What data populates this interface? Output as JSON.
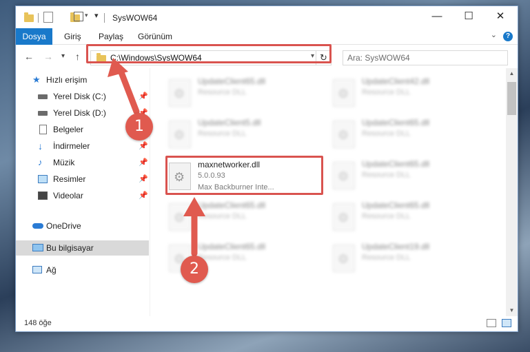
{
  "window": {
    "title": "SysWOW64"
  },
  "ribbon": {
    "tabs": [
      "Dosya",
      "Giriş",
      "Paylaş",
      "Görünüm"
    ],
    "help": "?"
  },
  "address": {
    "path": "C:\\Windows\\SysWOW64"
  },
  "search": {
    "placeholder": "Ara: SysWOW64"
  },
  "sidebar": {
    "items": [
      {
        "label": "Hızlı erişim",
        "icon": "star-icon",
        "pinned": false
      },
      {
        "label": "Yerel Disk (C:)",
        "icon": "drive-icon",
        "pinned": true
      },
      {
        "label": "Yerel Disk (D:)",
        "icon": "drive-icon",
        "pinned": true
      },
      {
        "label": "Belgeler",
        "icon": "document-icon",
        "pinned": true
      },
      {
        "label": "İndirmeler",
        "icon": "download-icon",
        "pinned": true
      },
      {
        "label": "Müzik",
        "icon": "music-icon",
        "pinned": true
      },
      {
        "label": "Resimler",
        "icon": "picture-icon",
        "pinned": true
      },
      {
        "label": "Videolar",
        "icon": "video-icon",
        "pinned": true
      },
      {
        "label": "OneDrive",
        "icon": "cloud-icon",
        "pinned": false
      },
      {
        "label": "Bu bilgisayar",
        "icon": "computer-icon",
        "pinned": false
      },
      {
        "label": "Ağ",
        "icon": "network-icon",
        "pinned": false
      }
    ]
  },
  "files": {
    "left": [
      {
        "name": "UpdateClient65.dll",
        "sub": "Resource DLL"
      },
      {
        "name": "UpdateClient5.dll",
        "sub": "Resource DLL"
      },
      {
        "name": "maxnetworker.dll",
        "sub": "5.0.0.93",
        "sub2": "Max Backburner Inte..."
      },
      {
        "name": "UpdateClient65.dll",
        "sub": "Resource DLL"
      },
      {
        "name": "UpdateClient65.dll",
        "sub": "Resource DLL"
      }
    ],
    "right": [
      {
        "name": "UpdateClient42.dll",
        "sub": "Resource DLL"
      },
      {
        "name": "UpdateClient65.dll",
        "sub": "Resource DLL"
      },
      {
        "name": "UpdateClient65.dll",
        "sub": "Resource DLL"
      },
      {
        "name": "UpdateClient65.dll",
        "sub": "Resource DLL"
      },
      {
        "name": "UpdateClient19.dll",
        "sub": "Resource DLL"
      }
    ]
  },
  "status": {
    "count": "148 öğe"
  },
  "callouts": [
    "1",
    "2"
  ],
  "colors": {
    "accent": "#1979ca",
    "highlight": "#d9534f",
    "callout": "#e05a4f"
  }
}
